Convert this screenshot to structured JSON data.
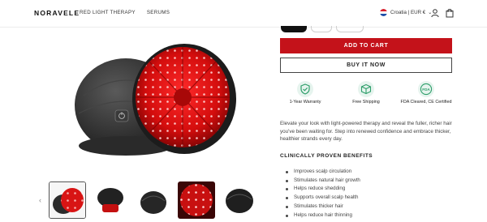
{
  "header": {
    "logo": "NORAVELE",
    "nav": [
      "RED LIGHT THERAPY",
      "SERUMS"
    ],
    "locale": "Croatia | EUR €"
  },
  "product": {
    "add_to_cart": "ADD TO CART",
    "buy_now": "BUY IT NOW",
    "features": [
      {
        "label": "1-Year Warranty",
        "icon": "shield-check-icon"
      },
      {
        "label": "Free Shipping",
        "icon": "package-icon"
      },
      {
        "label": "FDA Cleared, CE Certified",
        "icon": "fda-badge-icon"
      }
    ],
    "fda_text": "FDA",
    "description": "Elevate your look with light-powered therapy and reveal the fuller, richer hair you've been waiting for. Step into renewed confidence and embrace thicker, healthier strands every day.",
    "benefits_heading": "CLINICALLY PROVEN BENEFITS",
    "benefits": [
      "Improves scalp circulation",
      "Stimulates natural hair growth",
      "Helps reduce shedding",
      "Supports overall scalp health",
      "Stimulates thicker hair",
      "Helps reduce hair thinning"
    ]
  },
  "gallery": {
    "prev_arrow": "‹",
    "next_arrow": "›",
    "thumbnails": 5
  },
  "colors": {
    "accent_red": "#c4121a",
    "led_red": "#ff3b3b",
    "feature_green": "#2e9e6a"
  }
}
